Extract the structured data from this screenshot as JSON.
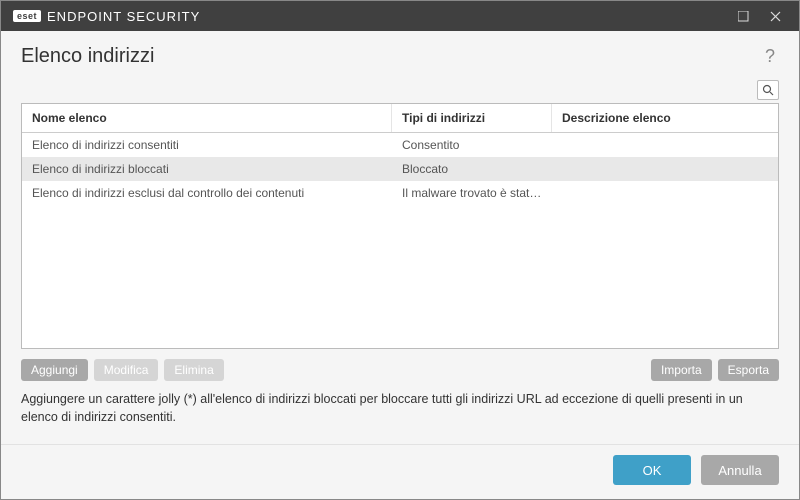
{
  "titlebar": {
    "brand_badge": "eset",
    "brand_text": "ENDPOINT SECURITY"
  },
  "header": {
    "title": "Elenco indirizzi",
    "help": "?"
  },
  "table": {
    "headers": {
      "name": "Nome elenco",
      "types": "Tipi di indirizzi",
      "desc": "Descrizione elenco"
    },
    "rows": [
      {
        "name": "Elenco di indirizzi consentiti",
        "types": "Consentito",
        "desc": "",
        "selected": false
      },
      {
        "name": "Elenco di indirizzi bloccati",
        "types": "Bloccato",
        "desc": "",
        "selected": true
      },
      {
        "name": "Elenco di indirizzi esclusi dal controllo dei contenuti",
        "types": "Il malware trovato è stato ...",
        "desc": "",
        "selected": false
      }
    ]
  },
  "actions": {
    "add": "Aggiungi",
    "edit": "Modifica",
    "delete": "Elimina",
    "import": "Importa",
    "export": "Esporta"
  },
  "hint": "Aggiungere un carattere jolly (*) all'elenco di indirizzi bloccati per bloccare tutti gli indirizzi URL ad eccezione di quelli presenti in un elenco di indirizzi consentiti.",
  "footer": {
    "ok": "OK",
    "cancel": "Annulla"
  }
}
